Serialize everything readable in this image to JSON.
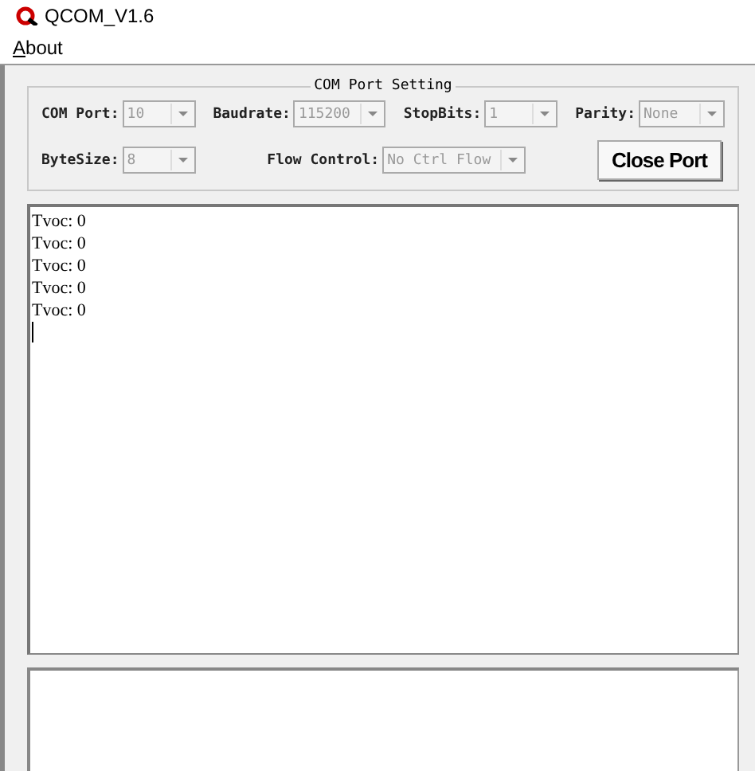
{
  "window": {
    "title": "QCOM_V1.6"
  },
  "menu": [
    {
      "label": "About",
      "mnemonic": true
    }
  ],
  "settings": {
    "title": "COM Port Setting",
    "rows": [
      [
        {
          "label": "COM Port:",
          "value": "10",
          "disabled": true
        },
        {
          "label": "Baudrate:",
          "value": "115200",
          "disabled": true
        },
        {
          "label": "StopBits:",
          "value": "1",
          "disabled": true
        },
        {
          "label": "Parity:",
          "value": "None",
          "disabled": true
        }
      ],
      [
        {
          "label": "ByteSize:",
          "value": "8",
          "disabled": true
        },
        {
          "label": "Flow Control:",
          "value": "No Ctrl Flow",
          "disabled": true
        }
      ]
    ],
    "button": "Close Port"
  },
  "output": {
    "lines": [
      "Tvoc: 0",
      "Tvoc: 0",
      "Tvoc: 0",
      "Tvoc: 0",
      "Tvoc: 0"
    ]
  }
}
